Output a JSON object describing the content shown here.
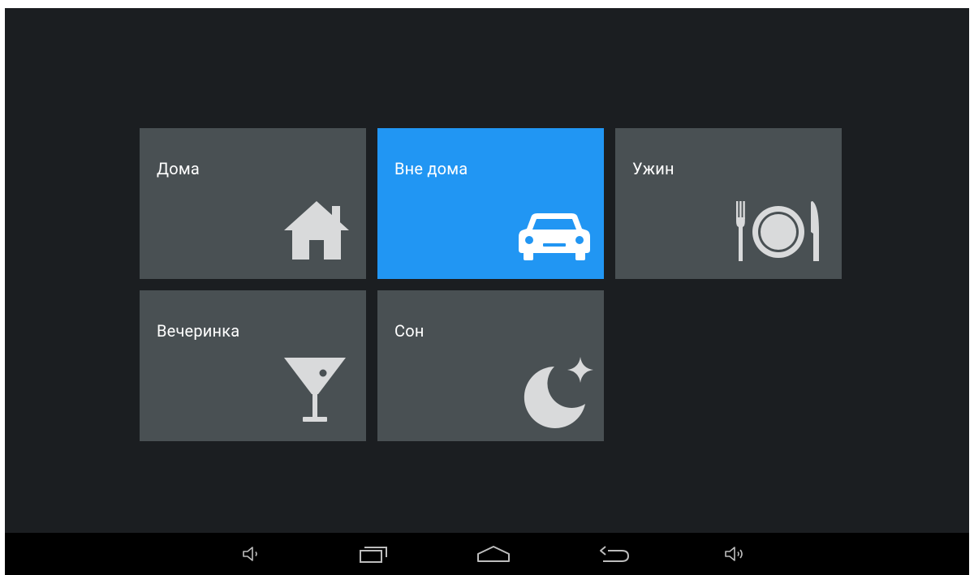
{
  "scenes": [
    {
      "label": "Дома",
      "icon": "home-icon",
      "active": false
    },
    {
      "label": "Вне дома",
      "icon": "car-icon",
      "active": true
    },
    {
      "label": "Ужин",
      "icon": "dinner-icon",
      "active": false
    },
    {
      "label": "Вечеринка",
      "icon": "cocktail-icon",
      "active": false
    },
    {
      "label": "Сон",
      "icon": "moon-icon",
      "active": false
    }
  ],
  "navigation": {
    "buttons": [
      "volume-down-icon",
      "recent-apps-icon",
      "home-nav-icon",
      "back-icon",
      "volume-up-icon"
    ]
  },
  "colors": {
    "background": "#1b1e21",
    "tile": "#495053",
    "tile_active": "#2196f3",
    "icon": "#d9dadb",
    "navbar": "#000000",
    "nav_icon": "#bdbdbd"
  }
}
